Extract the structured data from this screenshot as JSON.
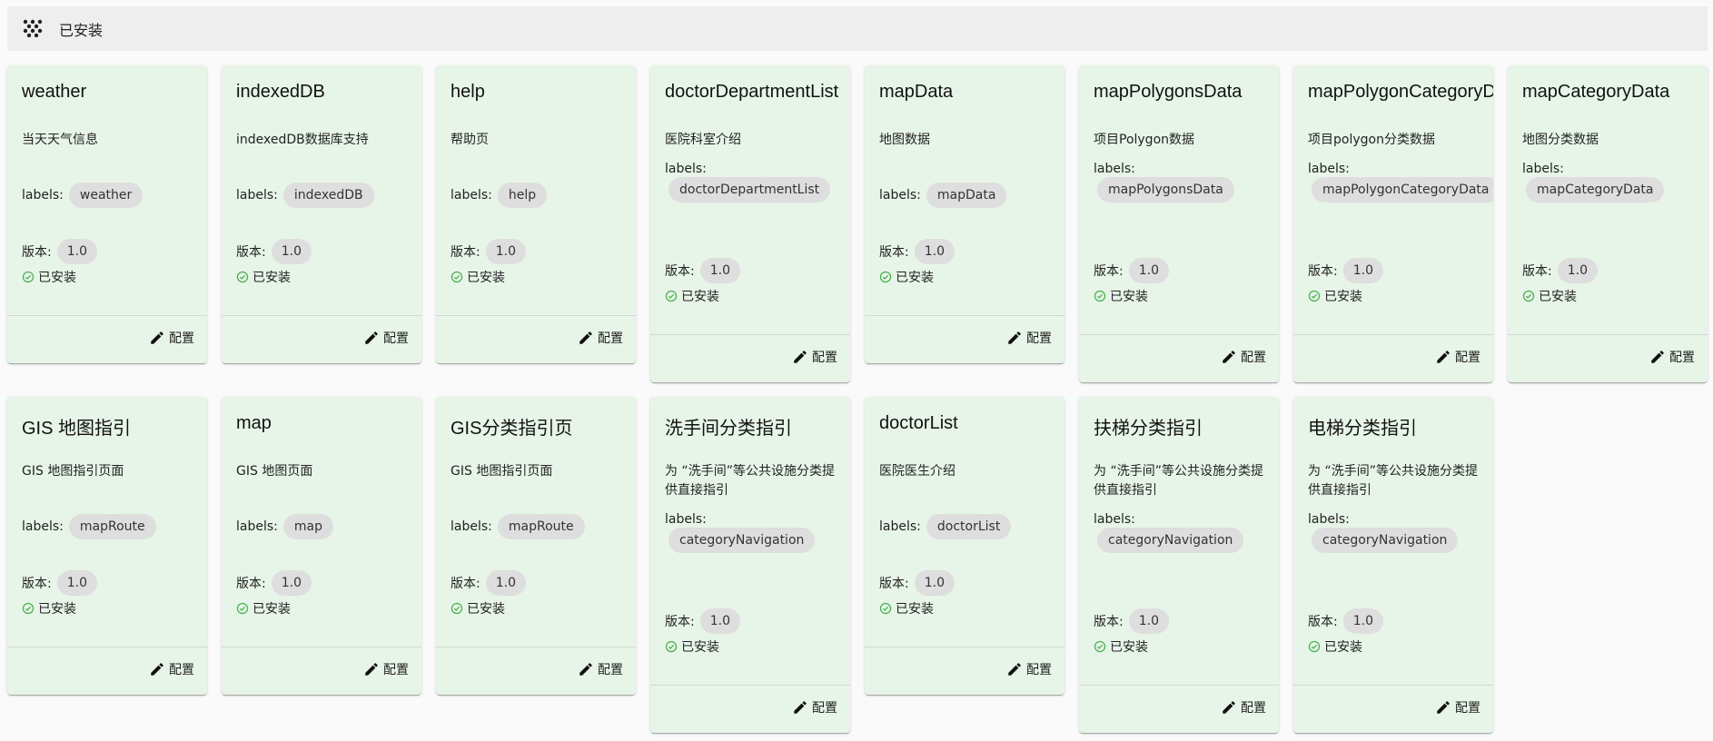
{
  "header": {
    "title": "已安装",
    "icon": "apps-dots-icon"
  },
  "common": {
    "labels_prefix": "labels:",
    "version_prefix": "版本:",
    "status_installed": "已安装",
    "config_label": "配置"
  },
  "colors": {
    "card_bg": "#e7f5e8",
    "header_bg": "#eeeeee",
    "chip_bg": "#dedede",
    "installed_green": "#4caf50"
  },
  "cards": [
    {
      "name": "weather",
      "description": "当天天气信息",
      "label": "weather",
      "version": "1.0"
    },
    {
      "name": "indexedDB",
      "description": "indexedDB数据库支持",
      "label": "indexedDB",
      "version": "1.0"
    },
    {
      "name": "help",
      "description": "帮助页",
      "label": "help",
      "version": "1.0"
    },
    {
      "name": "doctorDepartmentList",
      "description": "医院科室介绍",
      "label": "doctorDepartmentList",
      "version": "1.0"
    },
    {
      "name": "mapData",
      "description": "地图数据",
      "label": "mapData",
      "version": "1.0"
    },
    {
      "name": "mapPolygonsData",
      "description": "项目Polygon数据",
      "label": "mapPolygonsData",
      "version": "1.0"
    },
    {
      "name": "mapPolygonCategoryData",
      "description": "项目polygon分类数据",
      "label": "mapPolygonCategoryData",
      "version": "1.0"
    },
    {
      "name": "mapCategoryData",
      "description": "地图分类数据",
      "label": "mapCategoryData",
      "version": "1.0"
    },
    {
      "name": "GIS 地图指引",
      "description": "GIS 地图指引页面",
      "label": "mapRoute",
      "version": "1.0"
    },
    {
      "name": "map",
      "description": "GIS 地图页面",
      "label": "map",
      "version": "1.0"
    },
    {
      "name": "GIS分类指引页",
      "description": "GIS 地图指引页面",
      "label": "mapRoute",
      "version": "1.0"
    },
    {
      "name": "洗手间分类指引",
      "description": "为 “洗手间”等公共设施分类提供直接指引",
      "label": "categoryNavigation",
      "version": "1.0"
    },
    {
      "name": "doctorList",
      "description": "医院医生介绍",
      "label": "doctorList",
      "version": "1.0"
    },
    {
      "name": "扶梯分类指引",
      "description": "为 “洗手间”等公共设施分类提供直接指引",
      "label": "categoryNavigation",
      "version": "1.0"
    },
    {
      "name": "电梯分类指引",
      "description": "为 “洗手间”等公共设施分类提供直接指引",
      "label": "categoryNavigation",
      "version": "1.0"
    }
  ]
}
